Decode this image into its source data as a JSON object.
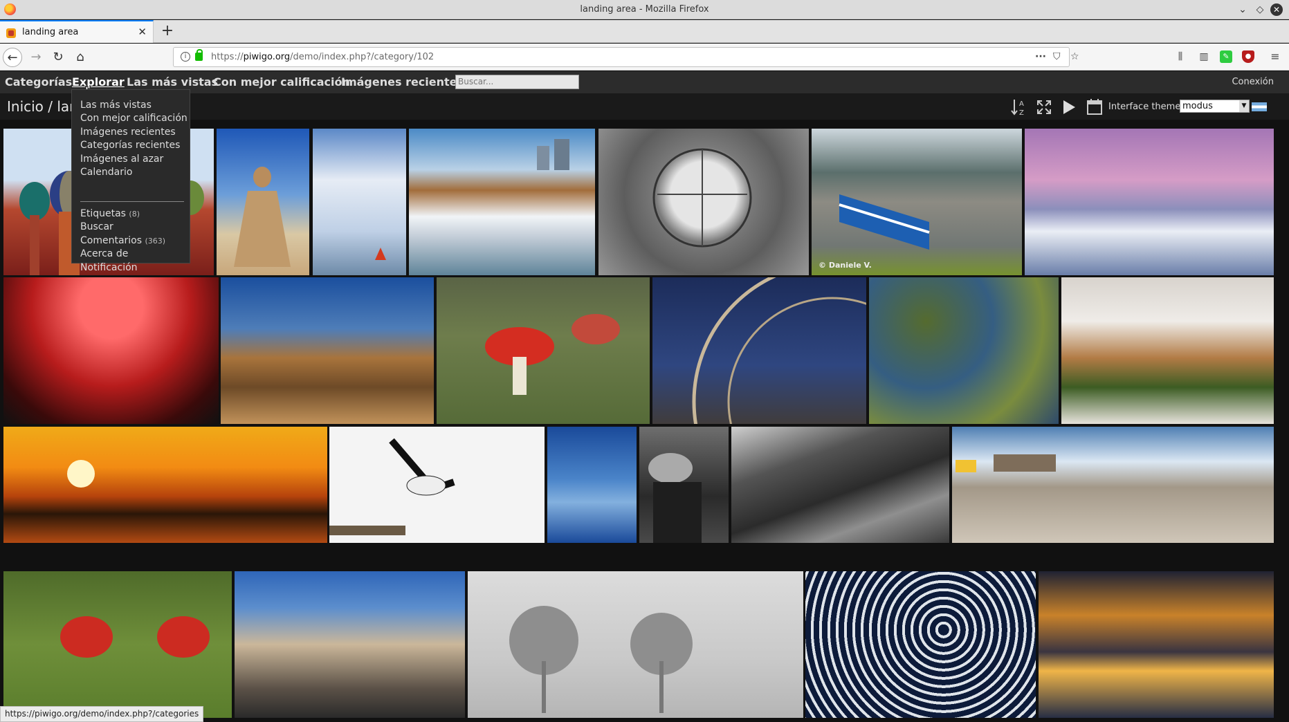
{
  "window": {
    "title": "landing area - Mozilla Firefox"
  },
  "tab": {
    "label": "landing area"
  },
  "urlbar": {
    "url_prefix": "https://",
    "url_host": "piwigo.org",
    "url_path": "/demo/index.php?/category/102"
  },
  "menu": {
    "items": [
      "Categorías",
      "Explorar",
      "Las más vistas",
      "Con mejor calificación",
      "Imágenes recientes"
    ],
    "search_placeholder": "Buscar...",
    "login": "Conexión"
  },
  "dropdown": {
    "items": [
      {
        "label": "Las más vistas"
      },
      {
        "label": "Con mejor calificación"
      },
      {
        "label": "Imágenes recientes"
      },
      {
        "label": "Categorías recientes"
      },
      {
        "label": "Imágenes al azar"
      },
      {
        "label": "Calendario"
      },
      {
        "label": "Etiquetas",
        "count": "(8)"
      },
      {
        "label": "Buscar"
      },
      {
        "label": "Comentarios",
        "count": "(363)"
      },
      {
        "label": "Acerca de"
      },
      {
        "label": "Notificación"
      }
    ]
  },
  "breadcrumb": "Inicio / lan",
  "theme": {
    "label": "Interface theme:",
    "value": "modus"
  },
  "photos": {
    "train_caption": "© Daniele V."
  },
  "status_url": "https://piwigo.org/demo/index.php?/categories"
}
